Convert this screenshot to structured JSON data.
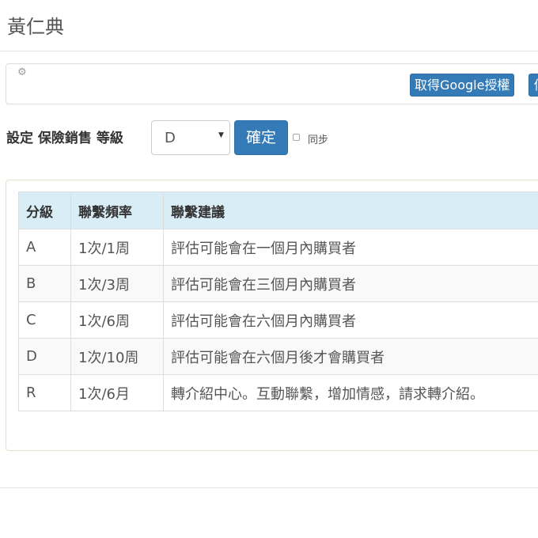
{
  "header": {
    "title": "黃仁典"
  },
  "toolbar": {
    "settings_icon": "gear-icon",
    "google_auth_label": "取得Google授權",
    "next_button_label": "個"
  },
  "level_form": {
    "label": "設定 保險銷售 等級",
    "selected_level": "D",
    "confirm_label": "確定",
    "sync_label": "同步",
    "sync_checked": false
  },
  "levels_table": {
    "headers": [
      "分級",
      "聯繫頻率",
      "聯繫建議"
    ],
    "rows": [
      [
        "A",
        "1次/1周",
        "評估可能會在一個月內購買者"
      ],
      [
        "B",
        "1次/3周",
        "評估可能會在三個月內購買者"
      ],
      [
        "C",
        "1次/6周",
        "評估可能會在六個月內購買者"
      ],
      [
        "D",
        "1次/10周",
        "評估可能會在六個月後才會購買者"
      ],
      [
        "R",
        "1次/6月",
        "轉介紹中心。互動聯繫，增加情感，請求轉介紹。"
      ]
    ]
  },
  "colors": {
    "primary": "#337ab7",
    "table_header": "#d9edf7",
    "striped_row": "#f9f9f9"
  }
}
